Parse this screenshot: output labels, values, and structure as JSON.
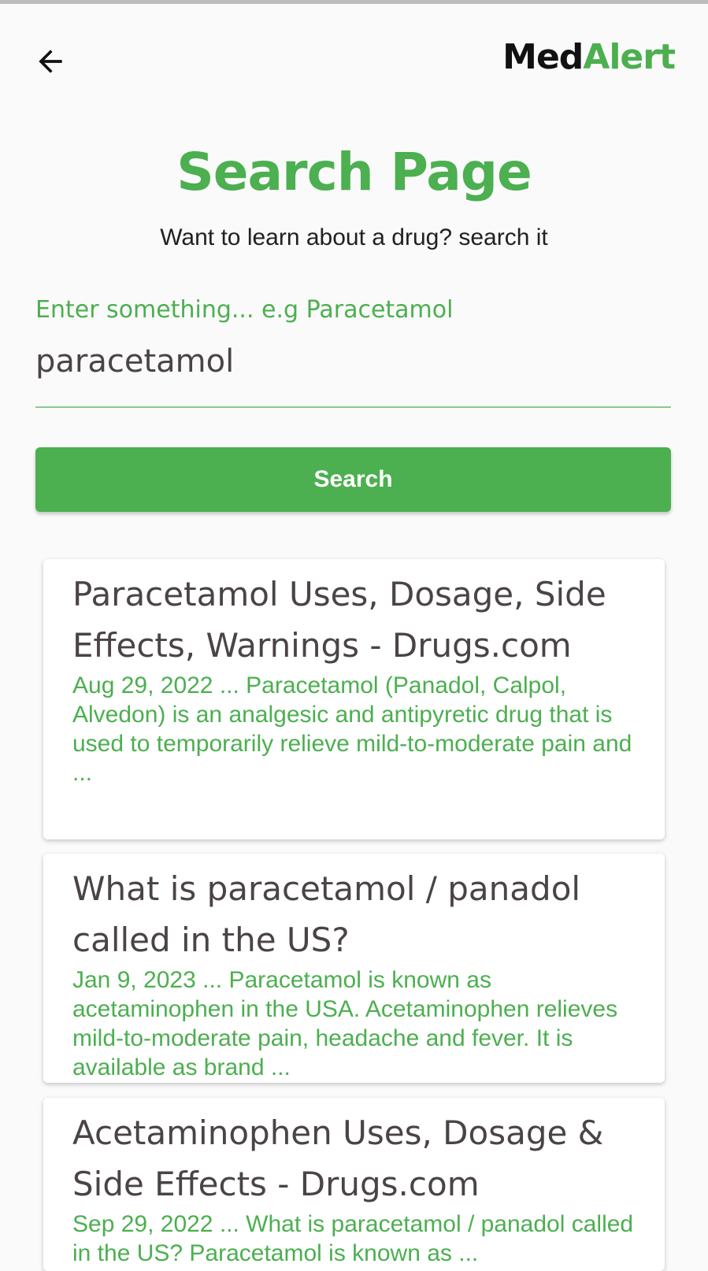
{
  "header": {
    "brand_part1": "Med",
    "brand_part2": "Alert",
    "accent_color": "#4caf50",
    "back_icon": "arrow-left-icon"
  },
  "page": {
    "title": "Search Page",
    "subtitle": "Want to learn about a drug? search it"
  },
  "search": {
    "label": "Enter something... e.g Paracetamol",
    "value": "paracetamol",
    "button_label": "Search"
  },
  "results": [
    {
      "title": "Paracetamol Uses, Dosage, Side Effects, Warnings - Drugs.com",
      "snippet": "Aug 29, 2022 ... Paracetamol (Panadol, Calpol, Alvedon) is an analgesic and antipyretic drug that is used to temporarily relieve mild-to-moderate pain and ..."
    },
    {
      "title": "What is paracetamol / panadol called in the US?",
      "snippet": "Jan 9, 2023 ... Paracetamol is known as acetaminophen in the USA. Acetaminophen relieves mild-to-moderate pain, headache and fever. It is available as brand ..."
    },
    {
      "title": "Acetaminophen Uses, Dosage & Side Effects - Drugs.com",
      "snippet": "Sep 29, 2022 ... What is paracetamol / panadol called in the US? Paracetamol is known as ..."
    }
  ]
}
